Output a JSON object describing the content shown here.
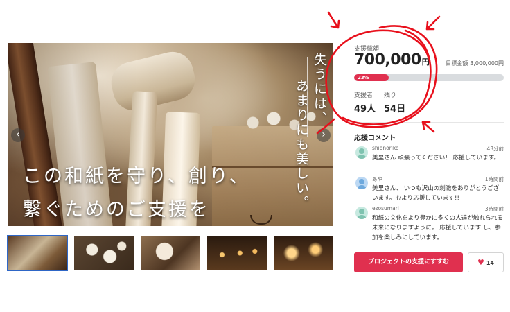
{
  "hero": {
    "vertical_line1": "失うには、",
    "vertical_line2": "あまりにも美しい。",
    "headline_line1": "この和紙を守り、創り、",
    "headline_line2": "繋ぐためのご支援を",
    "prev_icon": "chevron-left-icon",
    "next_icon": "chevron-right-icon"
  },
  "thumbnails": {
    "count": 5,
    "active_index": 0
  },
  "funding": {
    "total_label": "支援総額",
    "amount": "700,000",
    "amount_unit": "円",
    "goal_label": "目標金額",
    "goal_value": "3,000,000円",
    "percent_label": "23%",
    "percent_value": 0.23,
    "supporters_label": "支援者",
    "supporters_value": "49人",
    "remaining_label": "残り",
    "remaining_value": "54日"
  },
  "comments": {
    "title": "応援コメント",
    "items": [
      {
        "name": "shionoriko",
        "time": "43分前",
        "text": "美里さん 頑張ってください！ 応援しています。",
        "avatar_color": "#7fc3b0"
      },
      {
        "name": "あや",
        "time": "1時間前",
        "text": "美里さん、 いつも沢山の刺激をありがとうございます。心より応援しています!!",
        "avatar_color": "#6ea9dd"
      },
      {
        "name": "ezosumari",
        "time": "3時間前",
        "text": "和紙の文化をより豊かに多くの人達が触れられる未来になりますように。 応援しています し、参加を楽しみにしています。",
        "avatar_color": "#7fc3b0"
      }
    ]
  },
  "actions": {
    "support_label": "プロジェクトの支援にすすむ",
    "favorite_icon": "heart-icon",
    "favorite_count": "14"
  },
  "colors": {
    "accent": "#e0304f",
    "annotation": "#e8101c",
    "thumb_active": "#2e66c6"
  }
}
